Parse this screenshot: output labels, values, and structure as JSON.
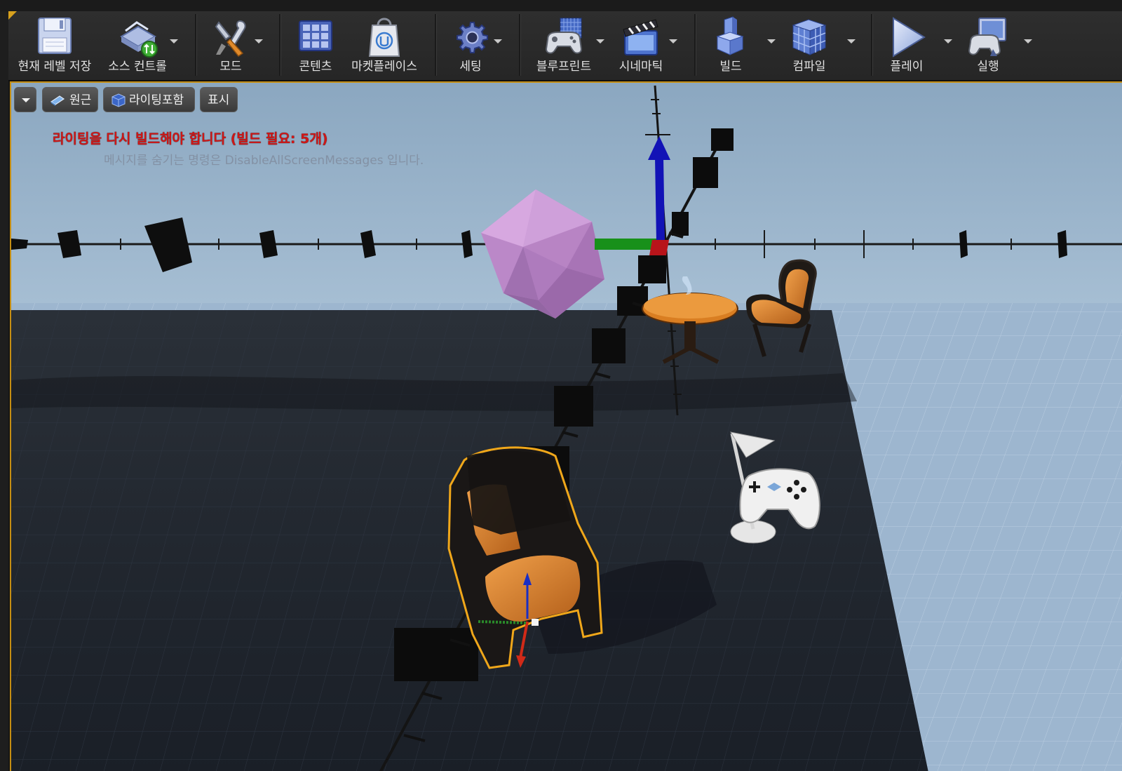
{
  "toolbar": {
    "buttons": [
      {
        "label": "현재 레벨 저장",
        "icon": "save-icon"
      },
      {
        "label": "소스 컨트롤",
        "icon": "source-control-icon"
      },
      {
        "label": "모드",
        "icon": "modes-icon"
      },
      {
        "label": "콘텐츠",
        "icon": "content-icon"
      },
      {
        "label": "마켓플레이스",
        "icon": "marketplace-icon"
      },
      {
        "label": "세팅",
        "icon": "settings-icon"
      },
      {
        "label": "블루프린트",
        "icon": "blueprint-icon"
      },
      {
        "label": "시네마틱",
        "icon": "cinematics-icon"
      },
      {
        "label": "빌드",
        "icon": "build-icon"
      },
      {
        "label": "컴파일",
        "icon": "compile-icon"
      },
      {
        "label": "플레이",
        "icon": "play-icon"
      },
      {
        "label": "실행",
        "icon": "launch-icon"
      }
    ],
    "accent": "#d8a11d"
  },
  "viewport": {
    "options_icon": "chevron-down-icon",
    "perspective_label": "원근",
    "view_mode_label": "라이팅포함",
    "show_label": "표시",
    "warning_message": "라이팅을 다시 빌드해야 합니다 (빌드 필요: 5개)",
    "hint_message": "메시지를 숨기는 명령은 DisableAllScreenMessages 입니다.",
    "colors": {
      "sky": "#93aec6",
      "floor": "#1c222b",
      "grid_outer": "#a9c2da",
      "selection": "#f0a71a",
      "warning": "#d01616",
      "gizmo_x": "#cc1d12",
      "gizmo_y": "#1a8a1a",
      "gizmo_z": "#1010b8"
    },
    "objects": [
      "icosahedron-mesh",
      "round-table",
      "chair",
      "selected-chair",
      "player-start"
    ]
  }
}
